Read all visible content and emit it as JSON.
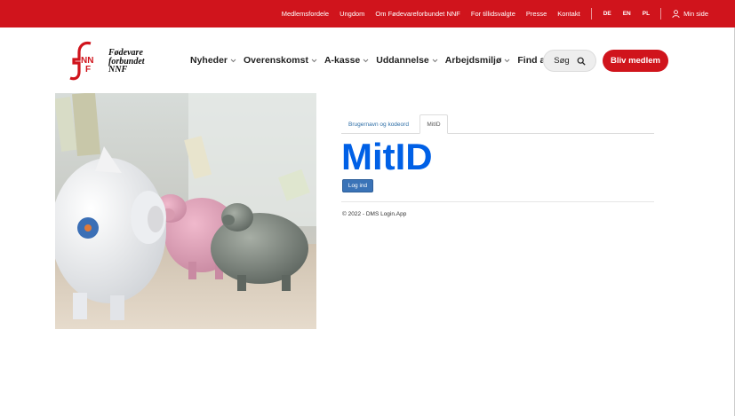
{
  "topbar": {
    "links": [
      "Medlemsfordele",
      "Ungdom",
      "Om Fødevareforbundet NNF",
      "For tillidsvalgte",
      "Presse",
      "Kontakt"
    ],
    "languages": [
      "DE",
      "EN",
      "PL"
    ],
    "my_page": "Min side"
  },
  "logo": {
    "mark": "NNF",
    "line1": "Fødevare",
    "line2": "forbundet",
    "line3": "NNF"
  },
  "nav": {
    "items": [
      "Nyheder",
      "Overenskomst",
      "A-kasse",
      "Uddannelse",
      "Arbejdsmiljø",
      "Find afdeling"
    ]
  },
  "search": {
    "label": "Søg"
  },
  "cta": {
    "label": "Bliv medlem"
  },
  "login": {
    "tabs": [
      "Brugernavn og kodeord",
      "MitID"
    ],
    "brand": "MitID",
    "button": "Log ind",
    "footer": "© 2022 - DMS Login.App"
  },
  "colors": {
    "brand_red": "#d0141c",
    "mitid_blue": "#0060e6",
    "button_blue": "#3a73b7"
  }
}
